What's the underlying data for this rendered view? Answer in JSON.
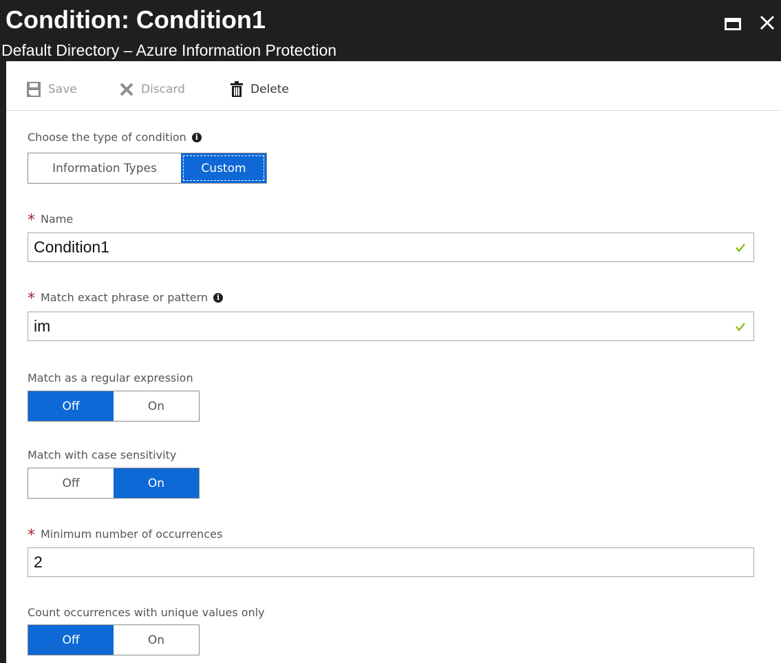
{
  "header": {
    "title": "Condition: Condition1",
    "subtitle": "Default Directory – Azure Information Protection"
  },
  "toolbar": {
    "save_label": "Save",
    "discard_label": "Discard",
    "delete_label": "Delete"
  },
  "condition_type": {
    "label": "Choose the type of condition",
    "options": [
      "Information Types",
      "Custom"
    ],
    "selected": "Custom"
  },
  "name_field": {
    "label": "Name",
    "value": "Condition1",
    "required": true
  },
  "pattern_field": {
    "label": "Match exact phrase or pattern",
    "value": "im",
    "required": true
  },
  "regex_toggle": {
    "label": "Match as a regular expression",
    "off_label": "Off",
    "on_label": "On",
    "selected": "Off"
  },
  "case_toggle": {
    "label": "Match with case sensitivity",
    "off_label": "Off",
    "on_label": "On",
    "selected": "On"
  },
  "occurrences_field": {
    "label": "Minimum number of occurrences",
    "value": "2",
    "required": true
  },
  "unique_toggle": {
    "label": "Count occurrences with unique values only",
    "off_label": "Off",
    "on_label": "On",
    "selected": "Off"
  },
  "colors": {
    "accent": "#0e68d6",
    "header_bg": "#1f1f1f",
    "required": "#a4262c",
    "valid_check": "#7fba00"
  },
  "icons": {
    "save": "save-icon",
    "discard": "close-x-icon",
    "delete": "trash-icon",
    "info": "info-icon",
    "valid": "checkmark-icon",
    "maximize": "maximize-icon",
    "close": "close-icon"
  }
}
